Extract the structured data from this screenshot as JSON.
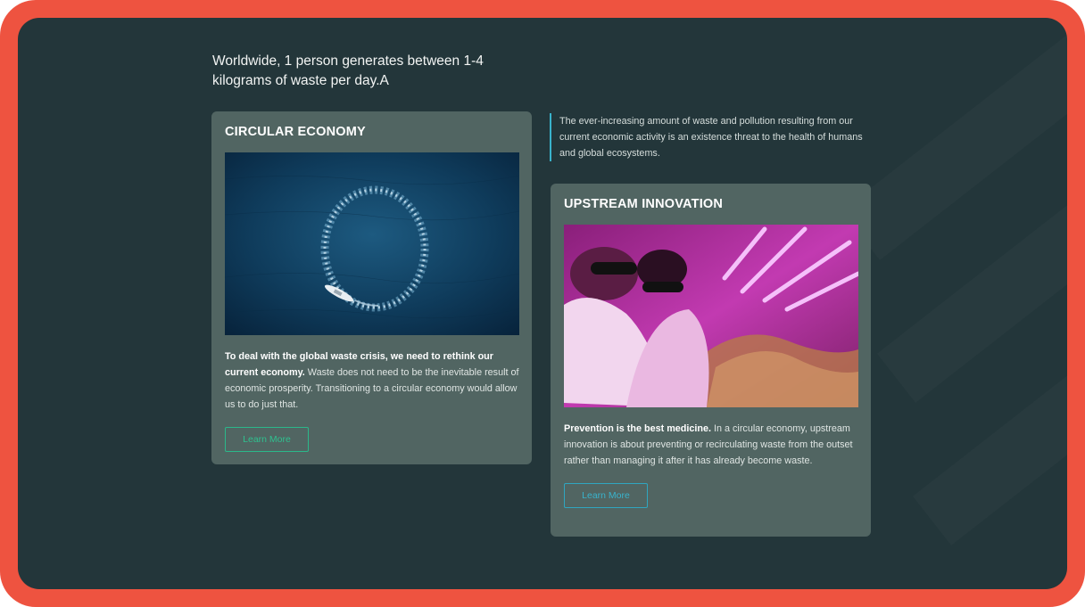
{
  "headline": "Worldwide, 1 person generates between 1-4 kilograms of waste per day.A",
  "quote": "The ever-increasing amount of waste and pollution resulting from our current economic activity is an existence threat to the health of humans and global ecosystems.",
  "cards": [
    {
      "title": "CIRCULAR ECONOMY",
      "bold": "To deal with the global waste crisis, we need to rethink our current economy.",
      "text": " Waste does not need to be the inevitable result of economic prosperity. Transitioning to a circular economy would allow us to do just that.",
      "button": "Learn More"
    },
    {
      "title": "UPSTREAM INNOVATION",
      "bold": "Prevention is the best medicine.",
      "text": " In a circular economy, upstream innovation is about preventing or recirculating waste from the outset rather than managing it after it has already become waste.",
      "button": "Learn More"
    }
  ],
  "colors": {
    "frame": "#ee5340",
    "panel": "#23363a",
    "card": "#516562",
    "accent_green": "#2fc08f",
    "accent_teal": "#39b3cc"
  }
}
